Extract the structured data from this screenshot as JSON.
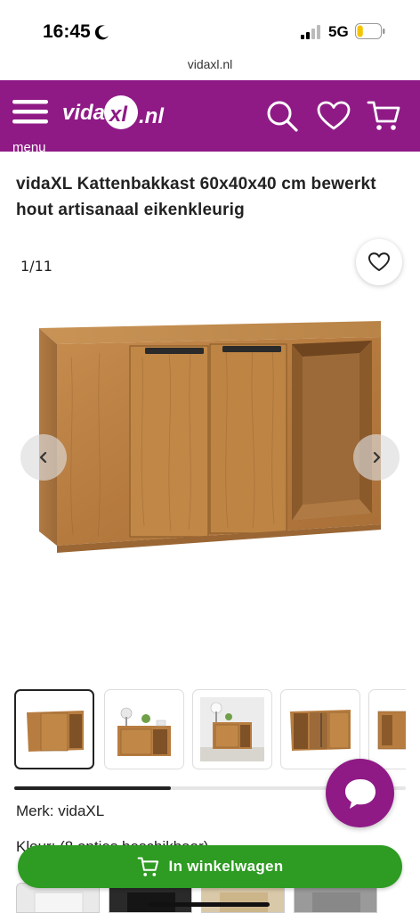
{
  "status_bar": {
    "time": "16:45",
    "network": "5G",
    "battery_level": 0.25
  },
  "browser": {
    "url": "vidaxl.nl"
  },
  "header": {
    "menu_label": "menu",
    "brand_color": "#8f1a86",
    "icons": [
      "menu-icon",
      "vidaxl-logo",
      "search-icon",
      "heart-icon",
      "cart-icon"
    ]
  },
  "product": {
    "title": "vidaXL Kattenbakkast 60x40x40 cm bewerkt hout artisanaal eikenkleurig",
    "image_counter": "1/11",
    "brand_line": "Merk: vidaXL",
    "color_line": "Kleur: (8 opties beschikbaar)"
  },
  "gallery": {
    "image_count": 11,
    "active_index": 0,
    "scroll_progress": 0.4
  },
  "cart": {
    "button_label": "In winkelwagen",
    "button_color": "#2e9b23"
  }
}
